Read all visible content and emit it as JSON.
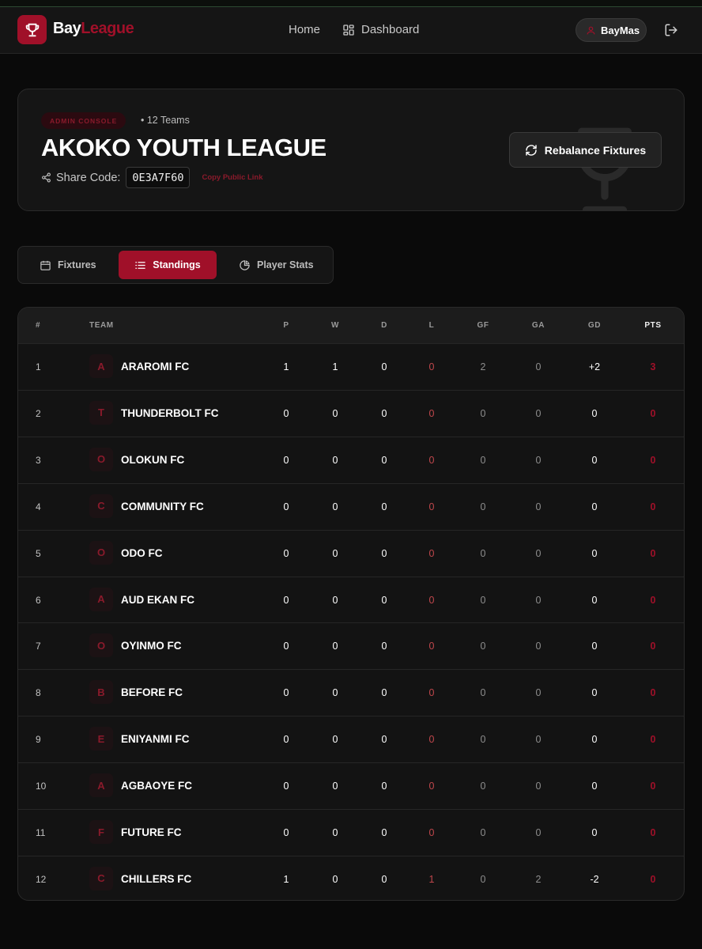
{
  "app": {
    "logo_part1": "Bay",
    "logo_part2": "League",
    "accent_color": "#a01029"
  },
  "nav": {
    "home": "Home",
    "dashboard": "Dashboard",
    "user": "BayMas"
  },
  "league": {
    "badge": "ADMIN CONSOLE",
    "team_count": "• 12 Teams",
    "title": "AKOKO YOUTH LEAGUE",
    "share_label": "Share Code:",
    "share_code": "0E3A7F60",
    "copy_link": "Copy Public Link",
    "rebalance": "Rebalance Fixtures"
  },
  "tabs": {
    "fixtures": "Fixtures",
    "standings": "Standings",
    "player_stats": "Player Stats",
    "active": "Standings"
  },
  "table": {
    "headers": [
      "#",
      "TEAM",
      "P",
      "W",
      "D",
      "L",
      "GF",
      "GA",
      "GD",
      "PTS"
    ],
    "rows": [
      {
        "rank": "1",
        "initial": "A",
        "team": "ARAROMI FC",
        "p": "1",
        "w": "1",
        "d": "0",
        "l": "0",
        "gf": "2",
        "ga": "0",
        "gd": "+2",
        "pts": "3"
      },
      {
        "rank": "2",
        "initial": "T",
        "team": "THUNDERBOLT FC",
        "p": "0",
        "w": "0",
        "d": "0",
        "l": "0",
        "gf": "0",
        "ga": "0",
        "gd": "0",
        "pts": "0"
      },
      {
        "rank": "3",
        "initial": "O",
        "team": "OLOKUN FC",
        "p": "0",
        "w": "0",
        "d": "0",
        "l": "0",
        "gf": "0",
        "ga": "0",
        "gd": "0",
        "pts": "0"
      },
      {
        "rank": "4",
        "initial": "C",
        "team": "COMMUNITY FC",
        "p": "0",
        "w": "0",
        "d": "0",
        "l": "0",
        "gf": "0",
        "ga": "0",
        "gd": "0",
        "pts": "0"
      },
      {
        "rank": "5",
        "initial": "O",
        "team": "ODO FC",
        "p": "0",
        "w": "0",
        "d": "0",
        "l": "0",
        "gf": "0",
        "ga": "0",
        "gd": "0",
        "pts": "0"
      },
      {
        "rank": "6",
        "initial": "A",
        "team": "AUD EKAN FC",
        "p": "0",
        "w": "0",
        "d": "0",
        "l": "0",
        "gf": "0",
        "ga": "0",
        "gd": "0",
        "pts": "0"
      },
      {
        "rank": "7",
        "initial": "O",
        "team": "OYINMO FC",
        "p": "0",
        "w": "0",
        "d": "0",
        "l": "0",
        "gf": "0",
        "ga": "0",
        "gd": "0",
        "pts": "0"
      },
      {
        "rank": "8",
        "initial": "B",
        "team": "BEFORE FC",
        "p": "0",
        "w": "0",
        "d": "0",
        "l": "0",
        "gf": "0",
        "ga": "0",
        "gd": "0",
        "pts": "0"
      },
      {
        "rank": "9",
        "initial": "E",
        "team": "ENIYANMI FC",
        "p": "0",
        "w": "0",
        "d": "0",
        "l": "0",
        "gf": "0",
        "ga": "0",
        "gd": "0",
        "pts": "0"
      },
      {
        "rank": "10",
        "initial": "A",
        "team": "AGBAOYE FC",
        "p": "0",
        "w": "0",
        "d": "0",
        "l": "0",
        "gf": "0",
        "ga": "0",
        "gd": "0",
        "pts": "0"
      },
      {
        "rank": "11",
        "initial": "F",
        "team": "FUTURE FC",
        "p": "0",
        "w": "0",
        "d": "0",
        "l": "0",
        "gf": "0",
        "ga": "0",
        "gd": "0",
        "pts": "0"
      },
      {
        "rank": "12",
        "initial": "C",
        "team": "CHILLERS FC",
        "p": "1",
        "w": "0",
        "d": "0",
        "l": "1",
        "gf": "0",
        "ga": "2",
        "gd": "-2",
        "pts": "0"
      }
    ]
  }
}
